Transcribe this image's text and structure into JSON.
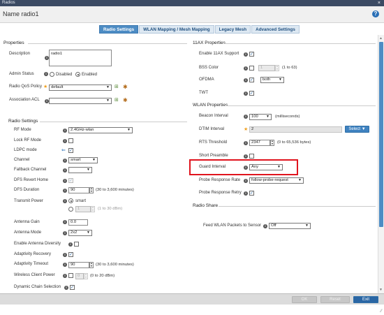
{
  "window": {
    "title": "Radios",
    "close_glyph": "×"
  },
  "header": {
    "name_label": "Name",
    "name_value": "radio1",
    "help_glyph": "?"
  },
  "tabs": [
    {
      "label": "Radio Settings",
      "active": true
    },
    {
      "label": "WLAN Mapping / Mesh Mapping",
      "active": false
    },
    {
      "label": "Legacy Mesh",
      "active": false
    },
    {
      "label": "Advanced Settings",
      "active": false
    }
  ],
  "properties": {
    "title": "Properties",
    "description_label": "Description",
    "description_value": "radio1",
    "admin_status_label": "Admin Status",
    "admin_disabled": "Disabled",
    "admin_enabled": "Enabled",
    "admin_selected": "Enabled",
    "qos_label": "Radio QoS Policy",
    "qos_value": "default",
    "acl_label": "Association ACL",
    "acl_value": ""
  },
  "radio_settings": {
    "title": "Radio Settings",
    "rf_mode_label": "RF Mode",
    "rf_mode_value": "2.4GHz-wlan",
    "lock_rf_label": "Lock RF Mode",
    "lock_rf_checked": false,
    "ldpc_label": "LDPC mode",
    "ldpc_checked": true,
    "channel_label": "Channel",
    "channel_value": "smart",
    "fallback_label": "Fallback Channel",
    "fallback_value": "",
    "dfs_revert_label": "DFS Revert Home",
    "dfs_revert_checked": true,
    "dfs_duration_label": "DFS Duration",
    "dfs_duration_value": "90",
    "dfs_duration_hint": "(30 to 3,600 minutes)",
    "tx_power_label": "Transmit Power",
    "tx_power_smart": "smart",
    "tx_power_value": "1",
    "tx_power_hint": "(1 to 30 dBm)",
    "antenna_gain_label": "Antenna Gain",
    "antenna_gain_value": "0.0",
    "antenna_mode_label": "Antenna Mode",
    "antenna_mode_value": "2x2",
    "ant_div_label": "Enable Antenna Diversity",
    "ant_div_checked": false,
    "adaptivity_recovery_label": "Adaptivity Recovery",
    "adaptivity_recovery_checked": true,
    "adaptivity_timeout_label": "Adaptivity Timeout",
    "adaptivity_timeout_value": "90",
    "adaptivity_timeout_hint": "(30 to 3,600 minutes)",
    "wcp_label": "Wireless Client Power",
    "wcp_value": "0",
    "wcp_hint": "(0 to 20 dBm)",
    "dcs_label": "Dynamic Chain Selection",
    "dcs_checked": true
  },
  "ax11": {
    "title": "11AX Properties",
    "enable_label": "Enable 11AX Support",
    "enable_checked": true,
    "bss_label": "BSS Color",
    "bss_value": "1",
    "bss_hint": "(1 to 63)",
    "bss_checked": false,
    "ofdma_label": "OFDMA",
    "ofdma_value": "both",
    "twt_label": "TWT",
    "twt_checked": true
  },
  "wlan_props": {
    "title": "WLAN Properties",
    "beacon_label": "Beacon Interval",
    "beacon_value": "100",
    "beacon_hint": "(milliseconds)",
    "dtim_label": "DTIM Interval",
    "dtim_value": "2",
    "dtim_button": "Select",
    "rts_label": "RTS Threshold",
    "rts_value": "2347",
    "rts_hint": "(0 to 65,536 bytes)",
    "short_preamble_label": "Short Preamble",
    "short_preamble_checked": false,
    "guard_label": "Guard Interval",
    "guard_value": "Any",
    "probe_rate_label": "Probe Response Rate",
    "probe_rate_value": "follow-probe-request",
    "probe_retry_label": "Probe Response Retry",
    "probe_retry_checked": true
  },
  "radio_share": {
    "title": "Radio Share",
    "feed_label": "Feed WLAN Packets to Sensor",
    "feed_value": "Off"
  },
  "footer": {
    "ok": "OK",
    "reset": "Reset",
    "exit": "Exit"
  },
  "glyphs": {
    "info": "i",
    "check": "✓",
    "caret": "▼",
    "spin_up": "▲",
    "spin_down": "▼",
    "star": "★",
    "create": "⊞",
    "gear": "✱",
    "scroll_up": "▲",
    "scroll_down": "▼",
    "ldpc": "⇐",
    "resize": "⁄⁄"
  },
  "colors": {
    "accent": "#4d8cc4",
    "highlight": "#e0141e",
    "titlebar": "#3b4a63"
  }
}
